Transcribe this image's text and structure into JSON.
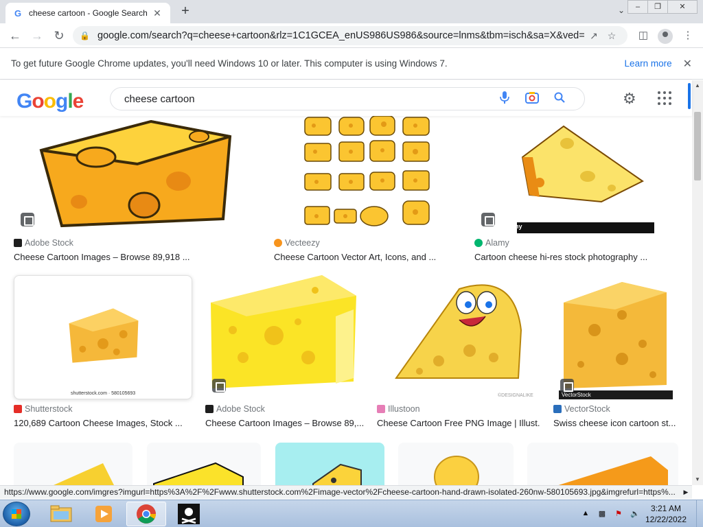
{
  "browser": {
    "tab_title": "cheese cartoon - Google Search",
    "tab_close": "✕",
    "new_tab": "+",
    "url": "google.com/search?q=cheese+cartoon&rlz=1C1GCEA_enUS986US986&source=lnms&tbm=isch&sa=X&ved=2...",
    "infobar_message": "To get future Google Chrome updates, you'll need Windows 10 or later. This computer is using Windows 7.",
    "infobar_link": "Learn more",
    "infobar_close": "✕"
  },
  "google": {
    "logo_letters": [
      "G",
      "o",
      "o",
      "g",
      "l",
      "e"
    ],
    "logo_colors": [
      "#4285f4",
      "#ea4335",
      "#fbbc05",
      "#4285f4",
      "#34a853",
      "#ea4335"
    ],
    "query": "cheese cartoon",
    "icons": [
      "mic-icon",
      "camera-icon",
      "search-icon",
      "gear-icon",
      "apps-icon"
    ]
  },
  "results": [
    {
      "source": "Adobe Stock",
      "caption": "Cheese Cartoon Images – Browse 89,918 ...",
      "fav_color": "#1e1e1e"
    },
    {
      "source": "Vecteezy",
      "caption": "Cheese Cartoon Vector Art, Icons, and ...",
      "fav_color": "#f7941d"
    },
    {
      "source": "Alamy",
      "caption": "Cartoon cheese hi-res stock photography ...",
      "fav_color": "#00b66f",
      "watermark": "alamy"
    },
    {
      "source": "Shutterstock",
      "caption": "120,689 Cartoon Cheese Images, Stock ...",
      "fav_color": "#e52d27",
      "watermark": "shutterstock.com · 580105693"
    },
    {
      "source": "Adobe Stock",
      "caption": "Cheese Cartoon Images – Browse 89,...",
      "fav_color": "#1e1e1e"
    },
    {
      "source": "Illustoon",
      "caption": "Cheese Cartoon Free PNG Image | Illust...",
      "fav_color": "#e67eb6",
      "watermark": "©DESIGNALIKE"
    },
    {
      "source": "VectorStock",
      "caption": "Swiss cheese icon cartoon st...",
      "fav_color": "#2a6ebb",
      "watermark": "VectorStock"
    }
  ],
  "status_link": "https://www.google.com/imgres?imgurl=https%3A%2F%2Fwww.shutterstock.com%2Fimage-vector%2Fcheese-cartoon-hand-drawn-isolated-260nw-580105693.jpg&imgrefurl=https%...",
  "taskbar": {
    "time": "3:21 AM",
    "date": "12/22/2022"
  }
}
